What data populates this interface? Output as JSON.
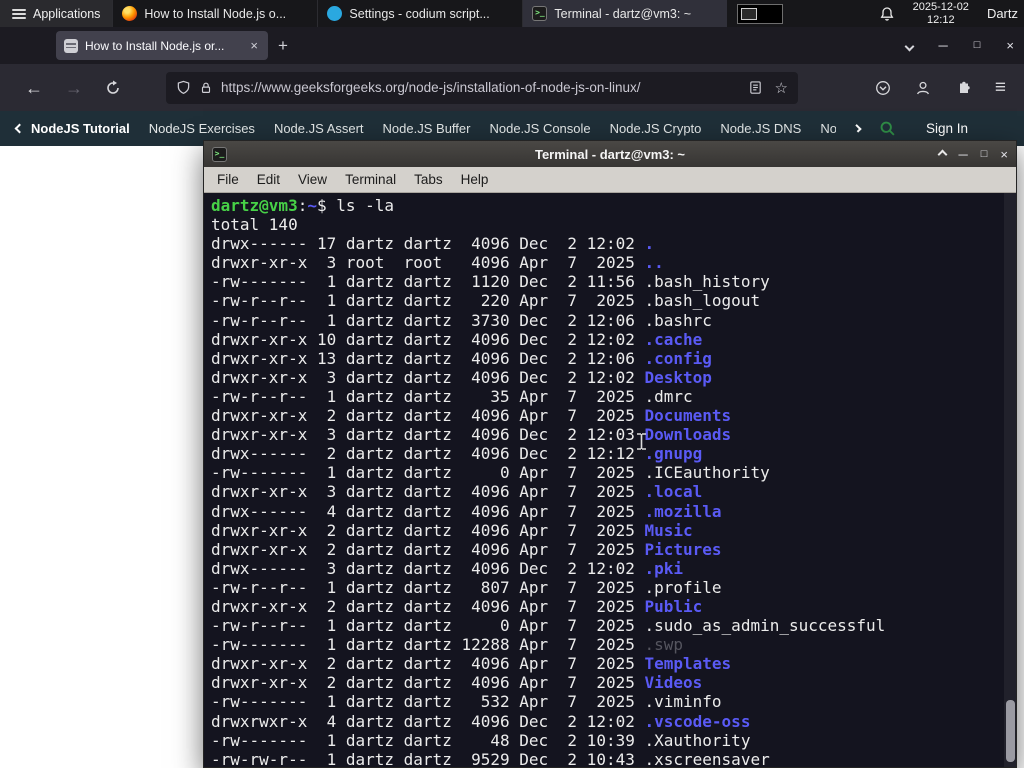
{
  "icons": {
    "back": "←",
    "forward": "→",
    "hamburger": "≡",
    "star": "☆",
    "new_tab": "+",
    "close_tab": "×",
    "minimize": "─",
    "maximize": "□",
    "close": "×"
  },
  "panel": {
    "applications_label": "Applications",
    "tasks": [
      {
        "title": "How to Install Node.js o..."
      },
      {
        "title": "Settings - codium script..."
      },
      {
        "title": "Terminal - dartz@vm3: ~"
      }
    ],
    "clock_date": "2025-12-02",
    "clock_time": "12:12",
    "user": "Dartz"
  },
  "browser": {
    "tab_title": "How to Install Node.js or...",
    "url": "https://www.geeksforgeeks.org/node-js/installation-of-node-js-on-linux/"
  },
  "gfg": {
    "items": [
      "NodeJS Tutorial",
      "NodeJS Exercises",
      "Node.JS Assert",
      "Node.JS Buffer",
      "Node.JS Console",
      "Node.JS Crypto",
      "Node.JS DNS",
      "Node"
    ],
    "signin": "Sign In",
    "brand_green": "#2f8d46"
  },
  "terminal": {
    "title": "Terminal - dartz@vm3: ~",
    "menu": [
      "File",
      "Edit",
      "View",
      "Terminal",
      "Tabs",
      "Help"
    ],
    "prompt": {
      "user_host": "dartz@vm3",
      "colon": ":",
      "cwd": "~",
      "dollar": "$ ",
      "command": "ls -la"
    },
    "total_line": "total 140",
    "colors": {
      "background": "#14141f",
      "directory": "#5a5af5",
      "prompt_green": "#47d147"
    },
    "listing": [
      {
        "pre": "drwx------ 17 dartz dartz  4096 Dec  2 12:02 ",
        "name": ".",
        "cls": "dir"
      },
      {
        "pre": "drwxr-xr-x  3 root  root   4096 Apr  7  2025 ",
        "name": "..",
        "cls": "dir"
      },
      {
        "pre": "-rw-------  1 dartz dartz  1120 Dec  2 11:56 ",
        "name": ".bash_history",
        "cls": "file"
      },
      {
        "pre": "-rw-r--r--  1 dartz dartz   220 Apr  7  2025 ",
        "name": ".bash_logout",
        "cls": "file"
      },
      {
        "pre": "-rw-r--r--  1 dartz dartz  3730 Dec  2 12:06 ",
        "name": ".bashrc",
        "cls": "file"
      },
      {
        "pre": "drwxr-xr-x 10 dartz dartz  4096 Dec  2 12:02 ",
        "name": ".cache",
        "cls": "dir"
      },
      {
        "pre": "drwxr-xr-x 13 dartz dartz  4096 Dec  2 12:06 ",
        "name": ".config",
        "cls": "dir"
      },
      {
        "pre": "drwxr-xr-x  3 dartz dartz  4096 Dec  2 12:02 ",
        "name": "Desktop",
        "cls": "dir"
      },
      {
        "pre": "-rw-r--r--  1 dartz dartz    35 Apr  7  2025 ",
        "name": ".dmrc",
        "cls": "file"
      },
      {
        "pre": "drwxr-xr-x  2 dartz dartz  4096 Apr  7  2025 ",
        "name": "Documents",
        "cls": "dir"
      },
      {
        "pre": "drwxr-xr-x  3 dartz dartz  4096 Dec  2 12:03 ",
        "name": "Downloads",
        "cls": "dir"
      },
      {
        "pre": "drwx------  2 dartz dartz  4096 Dec  2 12:12 ",
        "name": ".gnupg",
        "cls": "dir"
      },
      {
        "pre": "-rw-------  1 dartz dartz     0 Apr  7  2025 ",
        "name": ".ICEauthority",
        "cls": "file"
      },
      {
        "pre": "drwxr-xr-x  3 dartz dartz  4096 Apr  7  2025 ",
        "name": ".local",
        "cls": "dir"
      },
      {
        "pre": "drwx------  4 dartz dartz  4096 Apr  7  2025 ",
        "name": ".mozilla",
        "cls": "dir"
      },
      {
        "pre": "drwxr-xr-x  2 dartz dartz  4096 Apr  7  2025 ",
        "name": "Music",
        "cls": "dir"
      },
      {
        "pre": "drwxr-xr-x  2 dartz dartz  4096 Apr  7  2025 ",
        "name": "Pictures",
        "cls": "dir"
      },
      {
        "pre": "drwx------  3 dartz dartz  4096 Dec  2 12:02 ",
        "name": ".pki",
        "cls": "dir"
      },
      {
        "pre": "-rw-r--r--  1 dartz dartz   807 Apr  7  2025 ",
        "name": ".profile",
        "cls": "file"
      },
      {
        "pre": "drwxr-xr-x  2 dartz dartz  4096 Apr  7  2025 ",
        "name": "Public",
        "cls": "dir"
      },
      {
        "pre": "-rw-r--r--  1 dartz dartz     0 Apr  7  2025 ",
        "name": ".sudo_as_admin_successful",
        "cls": "file"
      },
      {
        "pre": "-rw-------  1 dartz dartz 12288 Apr  7  2025 ",
        "name": ".swp",
        "cls": "dim"
      },
      {
        "pre": "drwxr-xr-x  2 dartz dartz  4096 Apr  7  2025 ",
        "name": "Templates",
        "cls": "dir"
      },
      {
        "pre": "drwxr-xr-x  2 dartz dartz  4096 Apr  7  2025 ",
        "name": "Videos",
        "cls": "dir"
      },
      {
        "pre": "-rw-------  1 dartz dartz   532 Apr  7  2025 ",
        "name": ".viminfo",
        "cls": "file"
      },
      {
        "pre": "drwxrwxr-x  4 dartz dartz  4096 Dec  2 12:02 ",
        "name": ".vscode-oss",
        "cls": "dir"
      },
      {
        "pre": "-rw-------  1 dartz dartz    48 Dec  2 10:39 ",
        "name": ".Xauthority",
        "cls": "file"
      },
      {
        "pre": "-rw-rw-r--  1 dartz dartz  9529 Dec  2 10:43 ",
        "name": ".xscreensaver",
        "cls": "file"
      }
    ]
  }
}
